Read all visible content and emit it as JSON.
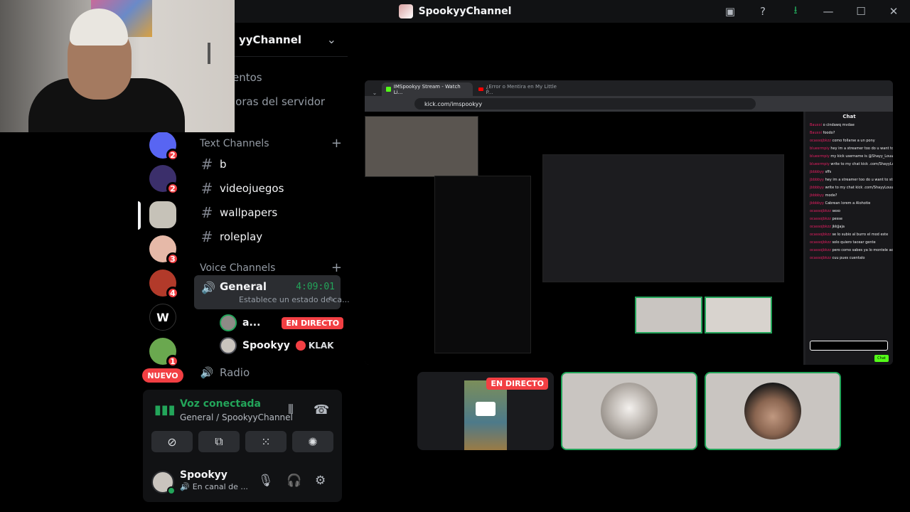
{
  "window": {
    "title": "SpookyyChannel",
    "controls": [
      "inbox-icon",
      "help-icon",
      "download-icon",
      "minimize-icon",
      "maximize-icon",
      "close-icon"
    ],
    "glyphs": {
      "inbox": "▣",
      "help": "?",
      "download": "⭳",
      "minimize": "—",
      "maximize": "☐",
      "close": "✕"
    }
  },
  "guild": {
    "name": "SpookyyChannel",
    "name_visible": "yyChannel",
    "chevron": "⌄",
    "menu_items": [
      {
        "label_visible": "entos"
      },
      {
        "label_visible": "joras del servidor"
      }
    ]
  },
  "servers": [
    {
      "name": "discord",
      "badge": "2",
      "color": "#5865f2"
    },
    {
      "name": "server-2",
      "badge": "2",
      "color": "#3b2f6b"
    },
    {
      "name": "server-3",
      "badge": "",
      "color": "#c6c2b8"
    },
    {
      "name": "server-4",
      "badge": "3",
      "color": "#e6b9a8"
    },
    {
      "name": "server-5",
      "badge": "4",
      "color": "#b23a2a"
    },
    {
      "name": "W",
      "badge": "",
      "color": "#000000",
      "letter": "W"
    },
    {
      "name": "server-7",
      "badge": "1",
      "color": "#6aa84f"
    }
  ],
  "nuevo_label": "NUEVO",
  "text_channels": {
    "category": "Text Channels",
    "add": "+",
    "items": [
      "b",
      "videojuegos",
      "wallpapers",
      "roleplay"
    ]
  },
  "voice_channels": {
    "category": "Voice Channels",
    "add": "+",
    "active": {
      "name": "General",
      "time": "4:09:01",
      "status": "Establece un estado de ca...",
      "edit_icon": "✎"
    },
    "users": [
      {
        "name": "a...",
        "tag": "EN DIRECTO"
      },
      {
        "name": "Spookyy",
        "tag": "KLAK"
      }
    ],
    "other": [
      "Radio"
    ]
  },
  "voice_panel": {
    "title": "Voz conectada",
    "subtitle": "General / SpookyyChannel",
    "icons": {
      "signal": "📶",
      "soundbars": "⦀",
      "disconnect": "☎",
      "camera_off": "⊘",
      "share_screen": "⧉",
      "activities": "⁙",
      "soundboard": "✺"
    }
  },
  "user": {
    "name": "Spookyy",
    "status": "En canal de ...",
    "speaker": "🔊",
    "controls": {
      "mic": "🎙",
      "headphones": "🎧",
      "settings": "⚙"
    }
  },
  "browser": {
    "tabs": [
      "IMSpookyy Stream - Watch Li...",
      "¿Error o Mentira en My Little P..."
    ],
    "url": "kick.com/imspookyy",
    "chat_title": "Chat",
    "chat_send": "Chat",
    "chat_messages": [
      {
        "u": "Bauxxi",
        "t": "o cindawq mvdae"
      },
      {
        "u": "Bauxxi",
        "t": "foodo?"
      },
      {
        "u": "ocassojbkzz",
        "t": "como follarse a un pony"
      },
      {
        "u": "bluesrmpiy",
        "t": "hey im a streamer too do u want to stream together?"
      },
      {
        "u": "bluesrmpiy",
        "t": "my kick username is @Shayy_Louu"
      },
      {
        "u": "bluesrmpiy",
        "t": "write to my chat kick .com/ShayyLouu"
      },
      {
        "u": "jbbbbyy",
        "t": "sffs"
      },
      {
        "u": "jbbbbyy",
        "t": "hey im a streamer too do u want to stream together?"
      },
      {
        "u": "jbbbbyy",
        "t": "write to my chat kick .com/ShayyLouu"
      },
      {
        "u": "jbbbbyy",
        "t": "mode?"
      },
      {
        "u": "jbbbbyy",
        "t": "Cabrean lorem a Alohotie"
      },
      {
        "u": "ocassojbkzz",
        "t": "sexo"
      },
      {
        "u": "ocassojbkzz",
        "t": "pesse"
      },
      {
        "u": "ocassojbkzz",
        "t": "jkkjjaja"
      },
      {
        "u": "ocassojbkzz",
        "t": "se lo subio al burro el mod este"
      },
      {
        "u": "ocassojbkzz",
        "t": "solo quiero tacear gente"
      },
      {
        "u": "ocassojbkzz",
        "t": "pero como sabes ya lo montele acaso?"
      },
      {
        "u": "ocassojbkzz",
        "t": "cuu pues cuentalo"
      }
    ]
  },
  "tiles": {
    "live_label": "EN DIRECTO"
  }
}
